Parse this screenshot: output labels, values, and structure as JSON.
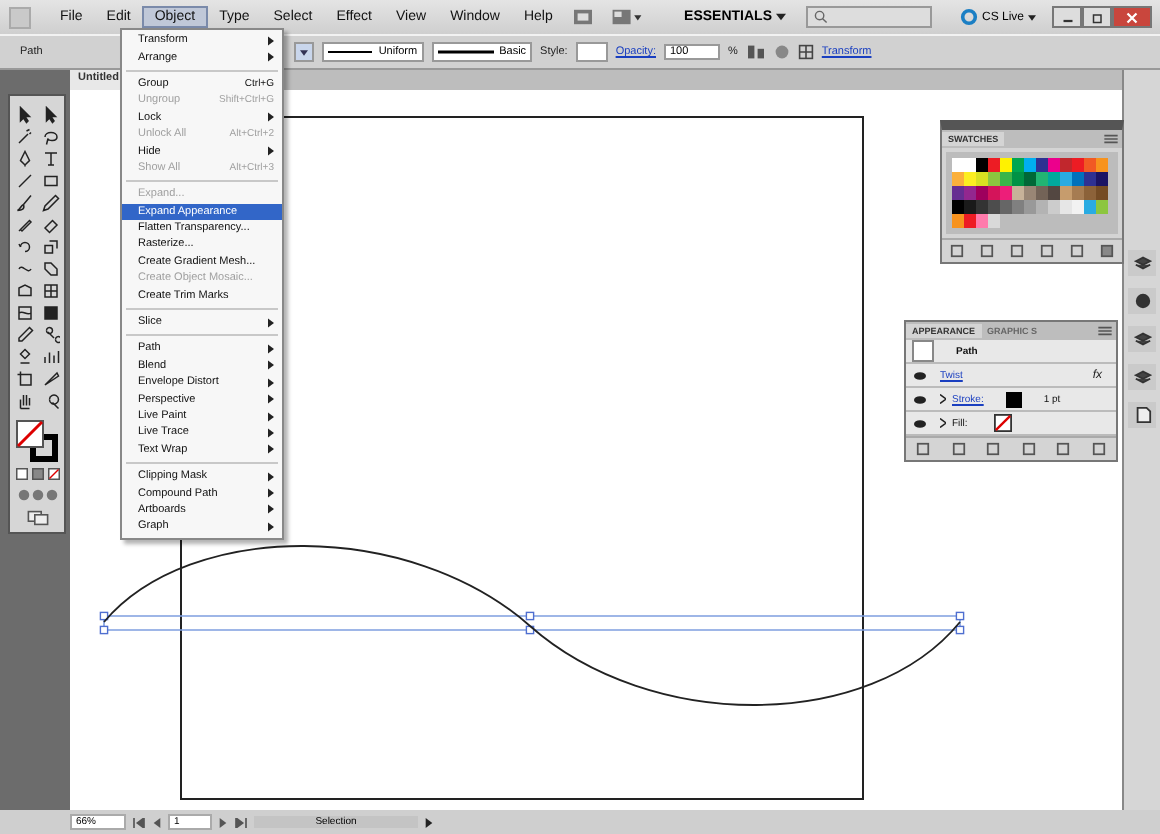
{
  "menu_bar": {
    "items": [
      {
        "label": "File",
        "selected": false
      },
      {
        "label": "Edit",
        "selected": false
      },
      {
        "label": "Object",
        "selected": true
      },
      {
        "label": "Type",
        "selected": false
      },
      {
        "label": "Select",
        "selected": false
      },
      {
        "label": "Effect",
        "selected": false
      },
      {
        "label": "View",
        "selected": false
      },
      {
        "label": "Window",
        "selected": false
      },
      {
        "label": "Help",
        "selected": false
      }
    ],
    "workspace": "ESSENTIALS",
    "cs_live": "CS Live"
  },
  "control_bar": {
    "selection": "Path",
    "profile": "Uniform",
    "brush": "Basic",
    "style_label": "Style:",
    "opacity_label": "Opacity:",
    "opacity": "100",
    "percent": "%",
    "transform": "Transform"
  },
  "document_tab": "Untitled",
  "object_menu": [
    [
      {
        "label": "Transform",
        "submenu": true,
        "disabled": false,
        "selected": false
      },
      {
        "label": "Arrange",
        "submenu": true,
        "disabled": false,
        "selected": false
      }
    ],
    [
      {
        "label": "Group",
        "shortcut": "Ctrl+G",
        "submenu": false,
        "disabled": false,
        "selected": false
      },
      {
        "label": "Ungroup",
        "shortcut": "Shift+Ctrl+G",
        "submenu": false,
        "disabled": true,
        "selected": false
      },
      {
        "label": "Lock",
        "submenu": true,
        "disabled": false,
        "selected": false
      },
      {
        "label": "Unlock All",
        "shortcut": "Alt+Ctrl+2",
        "submenu": false,
        "disabled": true,
        "selected": false
      },
      {
        "label": "Hide",
        "submenu": true,
        "disabled": false,
        "selected": false
      },
      {
        "label": "Show All",
        "shortcut": "Alt+Ctrl+3",
        "submenu": false,
        "disabled": true,
        "selected": false
      }
    ],
    [
      {
        "label": "Expand...",
        "submenu": false,
        "disabled": true,
        "selected": false
      },
      {
        "label": "Expand Appearance",
        "submenu": false,
        "disabled": false,
        "selected": true
      },
      {
        "label": "Flatten Transparency...",
        "submenu": false,
        "disabled": false,
        "selected": false
      },
      {
        "label": "Rasterize...",
        "submenu": false,
        "disabled": false,
        "selected": false
      },
      {
        "label": "Create Gradient Mesh...",
        "submenu": false,
        "disabled": false,
        "selected": false
      },
      {
        "label": "Create Object Mosaic...",
        "submenu": false,
        "disabled": true,
        "selected": false
      },
      {
        "label": "Create Trim Marks",
        "submenu": false,
        "disabled": false,
        "selected": false
      }
    ],
    [
      {
        "label": "Slice",
        "submenu": true,
        "disabled": false,
        "selected": false
      }
    ],
    [
      {
        "label": "Path",
        "submenu": true,
        "disabled": false,
        "selected": false
      },
      {
        "label": "Blend",
        "submenu": true,
        "disabled": false,
        "selected": false
      },
      {
        "label": "Envelope Distort",
        "submenu": true,
        "disabled": false,
        "selected": false
      },
      {
        "label": "Perspective",
        "submenu": true,
        "disabled": false,
        "selected": false
      },
      {
        "label": "Live Paint",
        "submenu": true,
        "disabled": false,
        "selected": false
      },
      {
        "label": "Live Trace",
        "submenu": true,
        "disabled": false,
        "selected": false
      },
      {
        "label": "Text Wrap",
        "submenu": true,
        "disabled": false,
        "selected": false
      }
    ],
    [
      {
        "label": "Clipping Mask",
        "submenu": true,
        "disabled": false,
        "selected": false
      },
      {
        "label": "Compound Path",
        "submenu": true,
        "disabled": false,
        "selected": false
      },
      {
        "label": "Artboards",
        "submenu": true,
        "disabled": false,
        "selected": false
      },
      {
        "label": "Graph",
        "submenu": true,
        "disabled": false,
        "selected": false
      }
    ]
  ],
  "swatches_panel": {
    "title": "SWATCHES",
    "swatches": [
      {
        "color": "#ffffff"
      },
      {
        "color": "#ffffff"
      },
      {
        "color": "#000000"
      },
      {
        "color": "#ed1c24"
      },
      {
        "color": "#fff200"
      },
      {
        "color": "#00a651"
      },
      {
        "color": "#00aeef"
      },
      {
        "color": "#2e3192"
      },
      {
        "color": "#ec008c"
      },
      {
        "color": "#c1272d"
      },
      {
        "color": "#ed1c24"
      },
      {
        "color": "#f15a24"
      },
      {
        "color": "#f7931e"
      },
      {
        "color": "#fbb03b"
      },
      {
        "color": "#fcee21"
      },
      {
        "color": "#d9e021"
      },
      {
        "color": "#8cc63f"
      },
      {
        "color": "#39b54a"
      },
      {
        "color": "#009245"
      },
      {
        "color": "#006837"
      },
      {
        "color": "#22b573"
      },
      {
        "color": "#00a99d"
      },
      {
        "color": "#29abe2"
      },
      {
        "color": "#0071bc"
      },
      {
        "color": "#2e3192"
      },
      {
        "color": "#1b1464"
      },
      {
        "color": "#662d91"
      },
      {
        "color": "#93278f"
      },
      {
        "color": "#9e005d"
      },
      {
        "color": "#d4145a"
      },
      {
        "color": "#ed1e79"
      },
      {
        "color": "#c7b299"
      },
      {
        "color": "#998675"
      },
      {
        "color": "#736357"
      },
      {
        "color": "#534741"
      },
      {
        "color": "#c69c6d"
      },
      {
        "color": "#a67c52"
      },
      {
        "color": "#8c6239"
      },
      {
        "color": "#754c24"
      },
      {
        "color": "#000000"
      },
      {
        "color": "#1a1a1a"
      },
      {
        "color": "#333333"
      },
      {
        "color": "#4d4d4d"
      },
      {
        "color": "#666666"
      },
      {
        "color": "#808080"
      },
      {
        "color": "#999999"
      },
      {
        "color": "#b3b3b3"
      },
      {
        "color": "#cccccc"
      },
      {
        "color": "#e6e6e6"
      },
      {
        "color": "#f2f2f2"
      },
      {
        "color": "#29abe2"
      },
      {
        "color": "#8cc63f"
      },
      {
        "color": "#f7931e"
      },
      {
        "color": "#ed1c24"
      },
      {
        "color": "#ff7bac"
      },
      {
        "color": "#d9d9d9"
      }
    ]
  },
  "appearance_panel": {
    "tabs": [
      {
        "label": "APPEARANCE",
        "selected": true
      },
      {
        "label": "GRAPHIC S",
        "selected": false
      }
    ],
    "rows": [
      {
        "kind": "header",
        "label": "Path"
      },
      {
        "kind": "effect",
        "label": "Twist",
        "badge": "fx"
      },
      {
        "kind": "stroke",
        "label": "Stroke:",
        "value": "1 pt"
      },
      {
        "kind": "fill",
        "label": "Fill:"
      }
    ]
  },
  "status_bar": {
    "zoom": "66%",
    "artboard": "1",
    "tool": "Selection"
  }
}
